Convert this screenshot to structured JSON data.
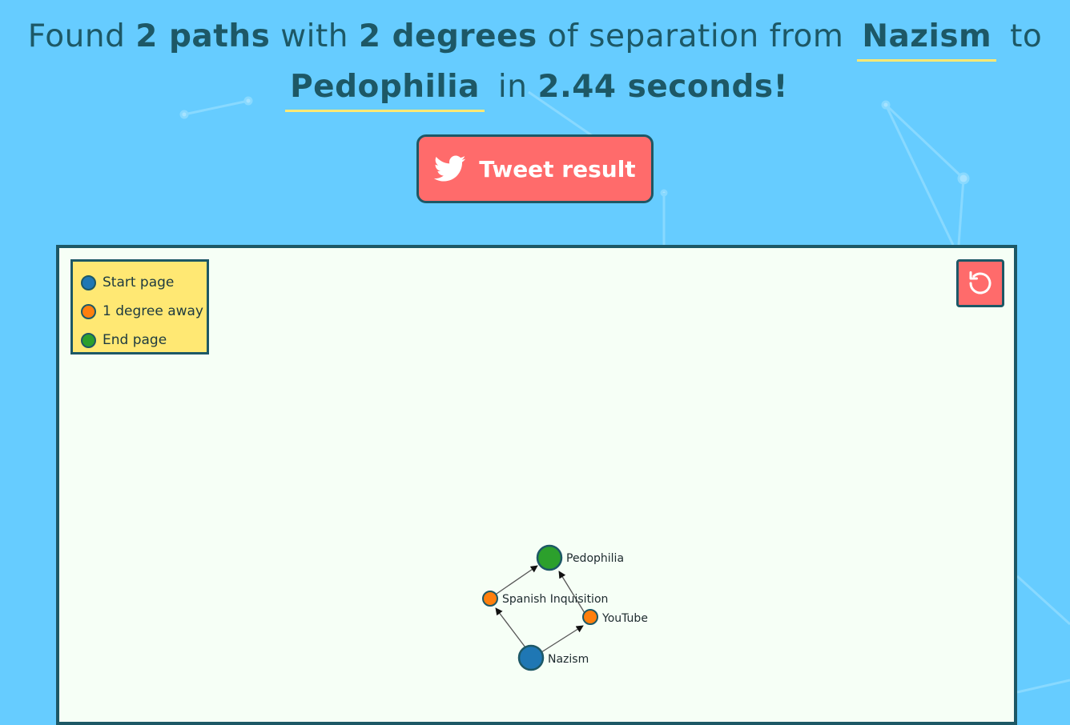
{
  "headline": {
    "found": "Found",
    "path_count": "2 paths",
    "with": "with",
    "degree_count": "2 degrees",
    "of_separation_from": "of separation from",
    "start_page": "Nazism",
    "to": "to",
    "end_page": "Pedophilia",
    "in": "in",
    "duration": "2.44 seconds!"
  },
  "tweet_button": {
    "label": "Tweet result",
    "icon": "twitter-bird-icon"
  },
  "reset_button": {
    "icon": "reset-icon"
  },
  "legend": {
    "items": [
      {
        "label": "Start page",
        "color": "#1f77b4"
      },
      {
        "label": "1 degree away",
        "color": "#ff7f0e"
      },
      {
        "label": "End page",
        "color": "#2ca02c"
      }
    ]
  },
  "graph": {
    "nodes": [
      {
        "id": "pedophilia",
        "label": "Pedophilia",
        "type": "end"
      },
      {
        "id": "spanish",
        "label": "Spanish Inquisition",
        "type": "middle"
      },
      {
        "id": "youtube",
        "label": "YouTube",
        "type": "middle"
      },
      {
        "id": "nazism",
        "label": "Nazism",
        "type": "start"
      }
    ],
    "edges": [
      {
        "from": "nazism",
        "to": "spanish"
      },
      {
        "from": "nazism",
        "to": "youtube"
      },
      {
        "from": "spanish",
        "to": "pedophilia"
      },
      {
        "from": "youtube",
        "to": "pedophilia"
      }
    ]
  },
  "colors": {
    "background": "#66ccff",
    "text": "#1d5866",
    "accent_underline": "#ffe873",
    "button": "#ff6b6b",
    "panel": "#f6fff6",
    "start_node": "#1f77b4",
    "middle_node": "#ff7f0e",
    "end_node": "#2ca02c"
  }
}
